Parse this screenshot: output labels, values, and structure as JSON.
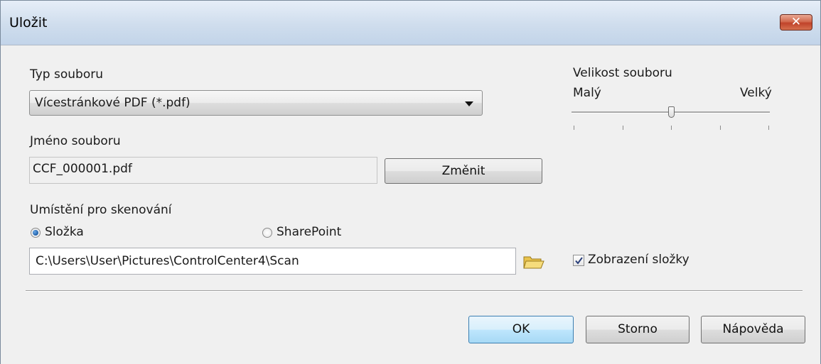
{
  "window": {
    "title": "Uložit",
    "close_label": "✕"
  },
  "file_type": {
    "label": "Typ souboru",
    "selected": "Vícestránkové PDF (*.pdf)"
  },
  "file_size": {
    "label": "Velikost souboru",
    "min_label": "Malý",
    "max_label": "Velký",
    "level": 0.5,
    "tick_count": 5
  },
  "file_name": {
    "label": "Jméno souboru",
    "value": "CCF_000001.pdf",
    "change_button": "Změnit"
  },
  "scan_location": {
    "label": "Umístění pro skenování",
    "options": [
      {
        "label": "Složka",
        "selected": true
      },
      {
        "label": "SharePoint",
        "selected": false
      }
    ],
    "path": "C:\\Users\\User\\Pictures\\ControlCenter4\\Scan",
    "folder_icon": "folder-browse-icon"
  },
  "show_folder": {
    "label": "Zobrazení složky",
    "checked": true
  },
  "buttons": {
    "ok": "OK",
    "cancel": "Storno",
    "help": "Nápověda"
  },
  "colors": {
    "accent": "#3c7fb1",
    "close": "#c0432a"
  }
}
